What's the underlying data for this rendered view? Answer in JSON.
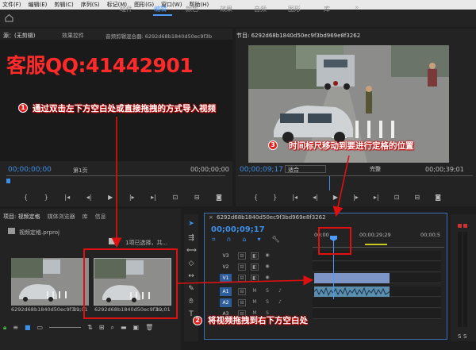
{
  "menu": [
    "文件(F)",
    "编辑(E)",
    "剪辑(C)",
    "序列(S)",
    "标记(M)",
    "图形(G)",
    "窗口(W)",
    "帮助(H)"
  ],
  "workspaces": [
    "组件",
    "编辑",
    "颜色",
    "效果",
    "音频",
    "图形",
    "库"
  ],
  "workspace_more": "»",
  "source_panel": {
    "tabs": [
      "源：(无剪辑)",
      "效果控件",
      "音频剪辑混合器: 6292d68b1840d50ec9f3b"
    ],
    "timecode": "00;00;00;00",
    "page": "第1页",
    "timecode_right": "00;00;00;00"
  },
  "program_panel": {
    "tab": "节目: 6292d68b1840d50ec9f3bd969e8f3262",
    "timecode": "00;00;09;17",
    "fit": "适合",
    "quality": "完整",
    "timecode_right": "00;00;39;01"
  },
  "project_panel": {
    "tabs": [
      "项目: 视频定格",
      "媒体浏览器",
      "库",
      "信息"
    ],
    "file": "视频定格.prproj",
    "count": "1项已选择，共...",
    "items": [
      {
        "name": "6292d68b1840d50ec9f3...",
        "duration": "39;01"
      },
      {
        "name": "6292d68b1840d50ec9f3...",
        "duration": "39;01"
      }
    ]
  },
  "timeline": {
    "sequence": "6292d68b1840d50ec9f3bd969e8f3262",
    "timecode": "00;00;09;17",
    "ruler": [
      "00;00",
      "00;00;29;29",
      "00;00;5"
    ],
    "video_tracks": [
      "V3",
      "V2",
      "V1"
    ],
    "audio_tracks": [
      "A1",
      "A2",
      "A3"
    ],
    "selected_track": "V1",
    "track_m": "M",
    "track_s": "S"
  },
  "watermark": "客服QQ:41442901",
  "annotations": [
    {
      "num": "1",
      "text": "通过双击左下方空白处或直接拖拽的方式导入视频"
    },
    {
      "num": "2",
      "text": "将视频拖拽到右下方空白处"
    },
    {
      "num": "3",
      "text": "时间标尺移动到要进行定格的位置"
    }
  ],
  "colors": {
    "accent": "#4c9cff",
    "annotation_red": "#e01010"
  }
}
